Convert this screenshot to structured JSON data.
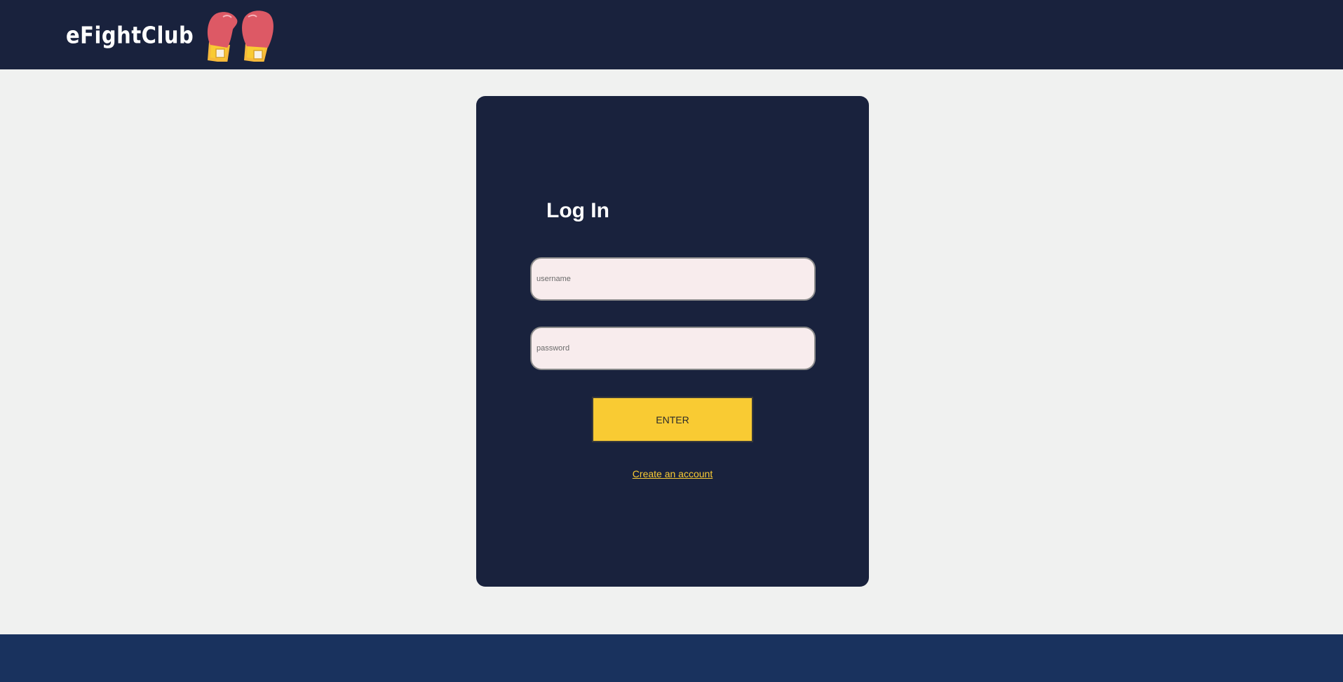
{
  "header": {
    "brand": "eFightClub",
    "logo_icon": "boxing-gloves-icon",
    "background_color": "#19223d"
  },
  "login": {
    "title": "Log In",
    "username_placeholder": "username",
    "password_placeholder": "password",
    "enter_label": "ENTER",
    "create_account_label": "Create an account",
    "card_color": "#19223d",
    "accent_color": "#f9cb33"
  },
  "footer": {
    "background_color": "#19325e"
  }
}
